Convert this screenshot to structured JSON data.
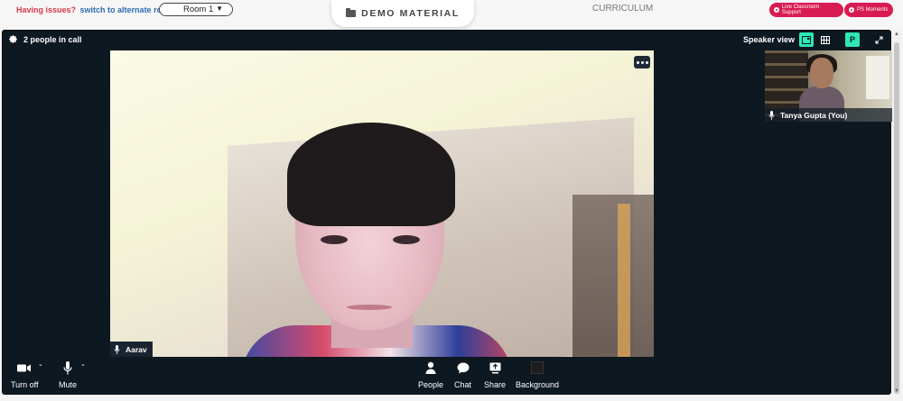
{
  "topbar": {
    "issues_text": "Having issues?",
    "alternate_link": "switch to alternate room",
    "room_select_value": "Room 1",
    "demo_button": "DEMO MATERIAL",
    "curriculum_label": "CURRICULUM",
    "live_support_label": "Live Classroom Support",
    "ps_moments_label": "PS Moments"
  },
  "call": {
    "people_count": "2 people in call",
    "view_mode_label": "Speaker view",
    "p_badge": "P",
    "main_participant": "Aarav",
    "self_participant": "Tanya Gupta (You)"
  },
  "controls": {
    "camera_label": "Turn off",
    "mic_label": "Mute",
    "people_label": "People",
    "chat_label": "Chat",
    "share_label": "Share",
    "background_label": "Background"
  },
  "colors": {
    "accent_teal": "#2ee8b3",
    "brand_pink": "#d81b52",
    "call_bg": "#0e1821",
    "issues_red": "#d6394b",
    "link_blue": "#2e6db4"
  },
  "icons": [
    "gear-icon",
    "speaker-view-icon",
    "grid-view-icon",
    "fullscreen-icon",
    "more-options-icon",
    "mic-icon",
    "camera-icon",
    "people-icon",
    "chat-icon",
    "share-icon",
    "background-icon",
    "folder-icon"
  ]
}
